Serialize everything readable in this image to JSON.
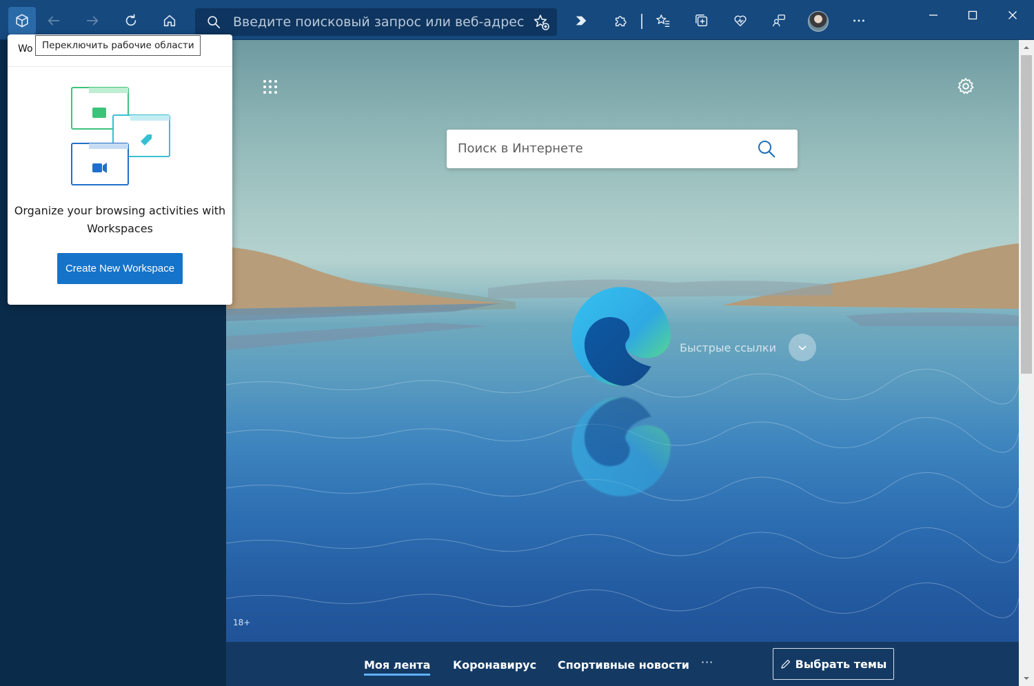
{
  "toolbar": {
    "address_placeholder": "Введите поисковый запрос или веб-адрес",
    "tooltip_switch_workspaces": "Переключить рабочие области"
  },
  "workspaces_popup": {
    "header_text": "Wo",
    "description": "Organize your browsing activities with Workspaces",
    "create_button_label": "Create New Workspace"
  },
  "newtab": {
    "search_placeholder": "Поиск в Интернете",
    "quick_links_label": "Быстрые ссылки",
    "age_badge": "18+"
  },
  "feed": {
    "tabs": [
      {
        "label": "Моя лента",
        "active": true
      },
      {
        "label": "Коронавирус",
        "active": false
      },
      {
        "label": "Спортивные новости",
        "active": false
      }
    ],
    "more_label": "···",
    "themes_button_label": "Выбрать темы"
  },
  "colors": {
    "toolbar_bg": "#16497e",
    "sidebar_bg": "#0b2b4a",
    "accent_blue": "#1573c9"
  },
  "icons": {
    "workspaces": "workspaces-icon",
    "back": "arrow-left-icon",
    "forward": "arrow-right-icon",
    "refresh": "refresh-icon",
    "home": "home-icon",
    "search": "search-icon",
    "add_favorite": "star-add-icon",
    "media_play": "play-icon",
    "extensions": "puzzle-icon",
    "favorites": "favorites-icon",
    "collections": "collections-icon",
    "performance": "heart-pulse-icon",
    "share": "share-icon",
    "more": "more-icon"
  }
}
